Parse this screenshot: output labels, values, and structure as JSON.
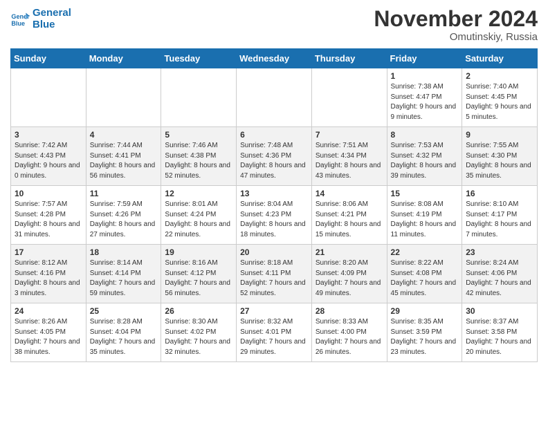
{
  "logo": {
    "line1": "General",
    "line2": "Blue"
  },
  "title": "November 2024",
  "location": "Omutinskiy, Russia",
  "days_of_week": [
    "Sunday",
    "Monday",
    "Tuesday",
    "Wednesday",
    "Thursday",
    "Friday",
    "Saturday"
  ],
  "weeks": [
    [
      {
        "day": "",
        "info": ""
      },
      {
        "day": "",
        "info": ""
      },
      {
        "day": "",
        "info": ""
      },
      {
        "day": "",
        "info": ""
      },
      {
        "day": "",
        "info": ""
      },
      {
        "day": "1",
        "info": "Sunrise: 7:38 AM\nSunset: 4:47 PM\nDaylight: 9 hours and 9 minutes."
      },
      {
        "day": "2",
        "info": "Sunrise: 7:40 AM\nSunset: 4:45 PM\nDaylight: 9 hours and 5 minutes."
      }
    ],
    [
      {
        "day": "3",
        "info": "Sunrise: 7:42 AM\nSunset: 4:43 PM\nDaylight: 9 hours and 0 minutes."
      },
      {
        "day": "4",
        "info": "Sunrise: 7:44 AM\nSunset: 4:41 PM\nDaylight: 8 hours and 56 minutes."
      },
      {
        "day": "5",
        "info": "Sunrise: 7:46 AM\nSunset: 4:38 PM\nDaylight: 8 hours and 52 minutes."
      },
      {
        "day": "6",
        "info": "Sunrise: 7:48 AM\nSunset: 4:36 PM\nDaylight: 8 hours and 47 minutes."
      },
      {
        "day": "7",
        "info": "Sunrise: 7:51 AM\nSunset: 4:34 PM\nDaylight: 8 hours and 43 minutes."
      },
      {
        "day": "8",
        "info": "Sunrise: 7:53 AM\nSunset: 4:32 PM\nDaylight: 8 hours and 39 minutes."
      },
      {
        "day": "9",
        "info": "Sunrise: 7:55 AM\nSunset: 4:30 PM\nDaylight: 8 hours and 35 minutes."
      }
    ],
    [
      {
        "day": "10",
        "info": "Sunrise: 7:57 AM\nSunset: 4:28 PM\nDaylight: 8 hours and 31 minutes."
      },
      {
        "day": "11",
        "info": "Sunrise: 7:59 AM\nSunset: 4:26 PM\nDaylight: 8 hours and 27 minutes."
      },
      {
        "day": "12",
        "info": "Sunrise: 8:01 AM\nSunset: 4:24 PM\nDaylight: 8 hours and 22 minutes."
      },
      {
        "day": "13",
        "info": "Sunrise: 8:04 AM\nSunset: 4:23 PM\nDaylight: 8 hours and 18 minutes."
      },
      {
        "day": "14",
        "info": "Sunrise: 8:06 AM\nSunset: 4:21 PM\nDaylight: 8 hours and 15 minutes."
      },
      {
        "day": "15",
        "info": "Sunrise: 8:08 AM\nSunset: 4:19 PM\nDaylight: 8 hours and 11 minutes."
      },
      {
        "day": "16",
        "info": "Sunrise: 8:10 AM\nSunset: 4:17 PM\nDaylight: 8 hours and 7 minutes."
      }
    ],
    [
      {
        "day": "17",
        "info": "Sunrise: 8:12 AM\nSunset: 4:16 PM\nDaylight: 8 hours and 3 minutes."
      },
      {
        "day": "18",
        "info": "Sunrise: 8:14 AM\nSunset: 4:14 PM\nDaylight: 7 hours and 59 minutes."
      },
      {
        "day": "19",
        "info": "Sunrise: 8:16 AM\nSunset: 4:12 PM\nDaylight: 7 hours and 56 minutes."
      },
      {
        "day": "20",
        "info": "Sunrise: 8:18 AM\nSunset: 4:11 PM\nDaylight: 7 hours and 52 minutes."
      },
      {
        "day": "21",
        "info": "Sunrise: 8:20 AM\nSunset: 4:09 PM\nDaylight: 7 hours and 49 minutes."
      },
      {
        "day": "22",
        "info": "Sunrise: 8:22 AM\nSunset: 4:08 PM\nDaylight: 7 hours and 45 minutes."
      },
      {
        "day": "23",
        "info": "Sunrise: 8:24 AM\nSunset: 4:06 PM\nDaylight: 7 hours and 42 minutes."
      }
    ],
    [
      {
        "day": "24",
        "info": "Sunrise: 8:26 AM\nSunset: 4:05 PM\nDaylight: 7 hours and 38 minutes."
      },
      {
        "day": "25",
        "info": "Sunrise: 8:28 AM\nSunset: 4:04 PM\nDaylight: 7 hours and 35 minutes."
      },
      {
        "day": "26",
        "info": "Sunrise: 8:30 AM\nSunset: 4:02 PM\nDaylight: 7 hours and 32 minutes."
      },
      {
        "day": "27",
        "info": "Sunrise: 8:32 AM\nSunset: 4:01 PM\nDaylight: 7 hours and 29 minutes."
      },
      {
        "day": "28",
        "info": "Sunrise: 8:33 AM\nSunset: 4:00 PM\nDaylight: 7 hours and 26 minutes."
      },
      {
        "day": "29",
        "info": "Sunrise: 8:35 AM\nSunset: 3:59 PM\nDaylight: 7 hours and 23 minutes."
      },
      {
        "day": "30",
        "info": "Sunrise: 8:37 AM\nSunset: 3:58 PM\nDaylight: 7 hours and 20 minutes."
      }
    ]
  ]
}
